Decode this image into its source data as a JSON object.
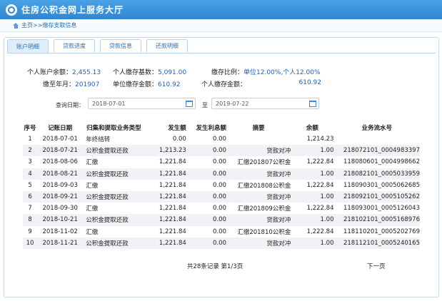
{
  "header": {
    "title": "住房公积金网上服务大厅"
  },
  "breadcrumb": {
    "home": "主页",
    "sep": ">>",
    "current": "缴存支取信息"
  },
  "tabs": [
    {
      "label": "账户明细"
    },
    {
      "label": "贷款进度"
    },
    {
      "label": "贷款信息"
    },
    {
      "label": "还款明细"
    }
  ],
  "account": {
    "balance_label": "个人账户余额：",
    "balance": "2,455.13",
    "base_label": "个人缴存基数：",
    "base": "5,091.00",
    "ratio_label": "缴存比例：",
    "ratio": "单位12.00%,个人12.00%",
    "until_label": "缴至年月：",
    "until": "201907",
    "unit_amount_label": "单位缴存金额：",
    "unit_amount": "610.92",
    "personal_amount_label": "个人缴存金额：",
    "personal_amount": "610.92"
  },
  "query": {
    "label": "查询日期：",
    "start": "2018-07-01",
    "to": "至",
    "end": "2019-07-22"
  },
  "table": {
    "headers": [
      "序号",
      "记账日期",
      "归集和提取业务类型",
      "发生额",
      "发生利息额",
      "摘要",
      "余额",
      "业务流水号"
    ],
    "rows": [
      [
        "1",
        "2018-07-01",
        "年终结转",
        "0.00",
        "0.00",
        "",
        "1,214.23",
        ""
      ],
      [
        "2",
        "2018-07-21",
        "公积金提取还款",
        "1,213.23",
        "0.00",
        "贷款对冲",
        "1.00",
        "218072101_0004983397"
      ],
      [
        "3",
        "2018-08-06",
        "汇缴",
        "1,221.84",
        "0.00",
        "汇缴201807公积金",
        "1,222.84",
        "118080601_0004998662"
      ],
      [
        "4",
        "2018-08-21",
        "公积金提取还款",
        "1,221.84",
        "0.00",
        "贷款对冲",
        "1.00",
        "218082101_0005033959"
      ],
      [
        "5",
        "2018-09-03",
        "汇缴",
        "1,221.84",
        "0.00",
        "汇缴201808公积金",
        "1,222.84",
        "118090301_0005062685"
      ],
      [
        "6",
        "2018-09-21",
        "公积金提取还款",
        "1,221.84",
        "0.00",
        "贷款对冲",
        "1.00",
        "218092101_0005105262"
      ],
      [
        "7",
        "2018-09-30",
        "汇缴",
        "1,221.84",
        "0.00",
        "汇缴201809公积金",
        "1,222.84",
        "118093001_0005126043"
      ],
      [
        "8",
        "2018-10-21",
        "公积金提取还款",
        "1,221.84",
        "0.00",
        "贷款对冲",
        "1.00",
        "218102101_0005168976"
      ],
      [
        "9",
        "2018-11-02",
        "汇缴",
        "1,221.84",
        "0.00",
        "汇缴201810公积金",
        "1,222.84",
        "118110201_0005202769"
      ],
      [
        "10",
        "2018-11-21",
        "公积金提取还款",
        "1,221.84",
        "0.00",
        "贷款对冲",
        "1.00",
        "218112101_0005240165"
      ]
    ]
  },
  "pager": {
    "summary": "共28条记录  第1/3页",
    "next": "下一页"
  }
}
